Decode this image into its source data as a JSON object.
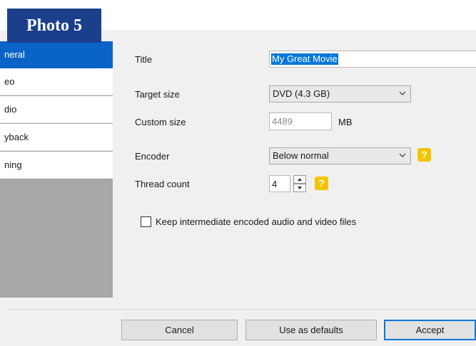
{
  "badge": {
    "label": "Photo 5"
  },
  "sidebar": {
    "items": [
      {
        "label": "neral",
        "active": true
      },
      {
        "label": "eo",
        "active": false
      },
      {
        "label": "dio",
        "active": false
      },
      {
        "label": "yback",
        "active": false
      },
      {
        "label": "ning",
        "active": false
      }
    ]
  },
  "form": {
    "title": {
      "label": "Title",
      "value": "My Great Movie"
    },
    "target_size": {
      "label": "Target size",
      "value": "DVD (4.3 GB)"
    },
    "custom_size": {
      "label": "Custom size",
      "value": "4489",
      "unit": "MB"
    },
    "encoder": {
      "label": "Encoder",
      "value": "Below normal",
      "help": "?"
    },
    "thread_count": {
      "label": "Thread count",
      "value": "4",
      "help": "?"
    },
    "keep_files": {
      "label": "Keep intermediate encoded audio and video files",
      "checked": false
    }
  },
  "buttons": {
    "cancel": "Cancel",
    "defaults": "Use as defaults",
    "accept": "Accept"
  },
  "colors": {
    "selection": "#0078d7",
    "help": "#f2c400",
    "badge": "#1b3f8b"
  }
}
